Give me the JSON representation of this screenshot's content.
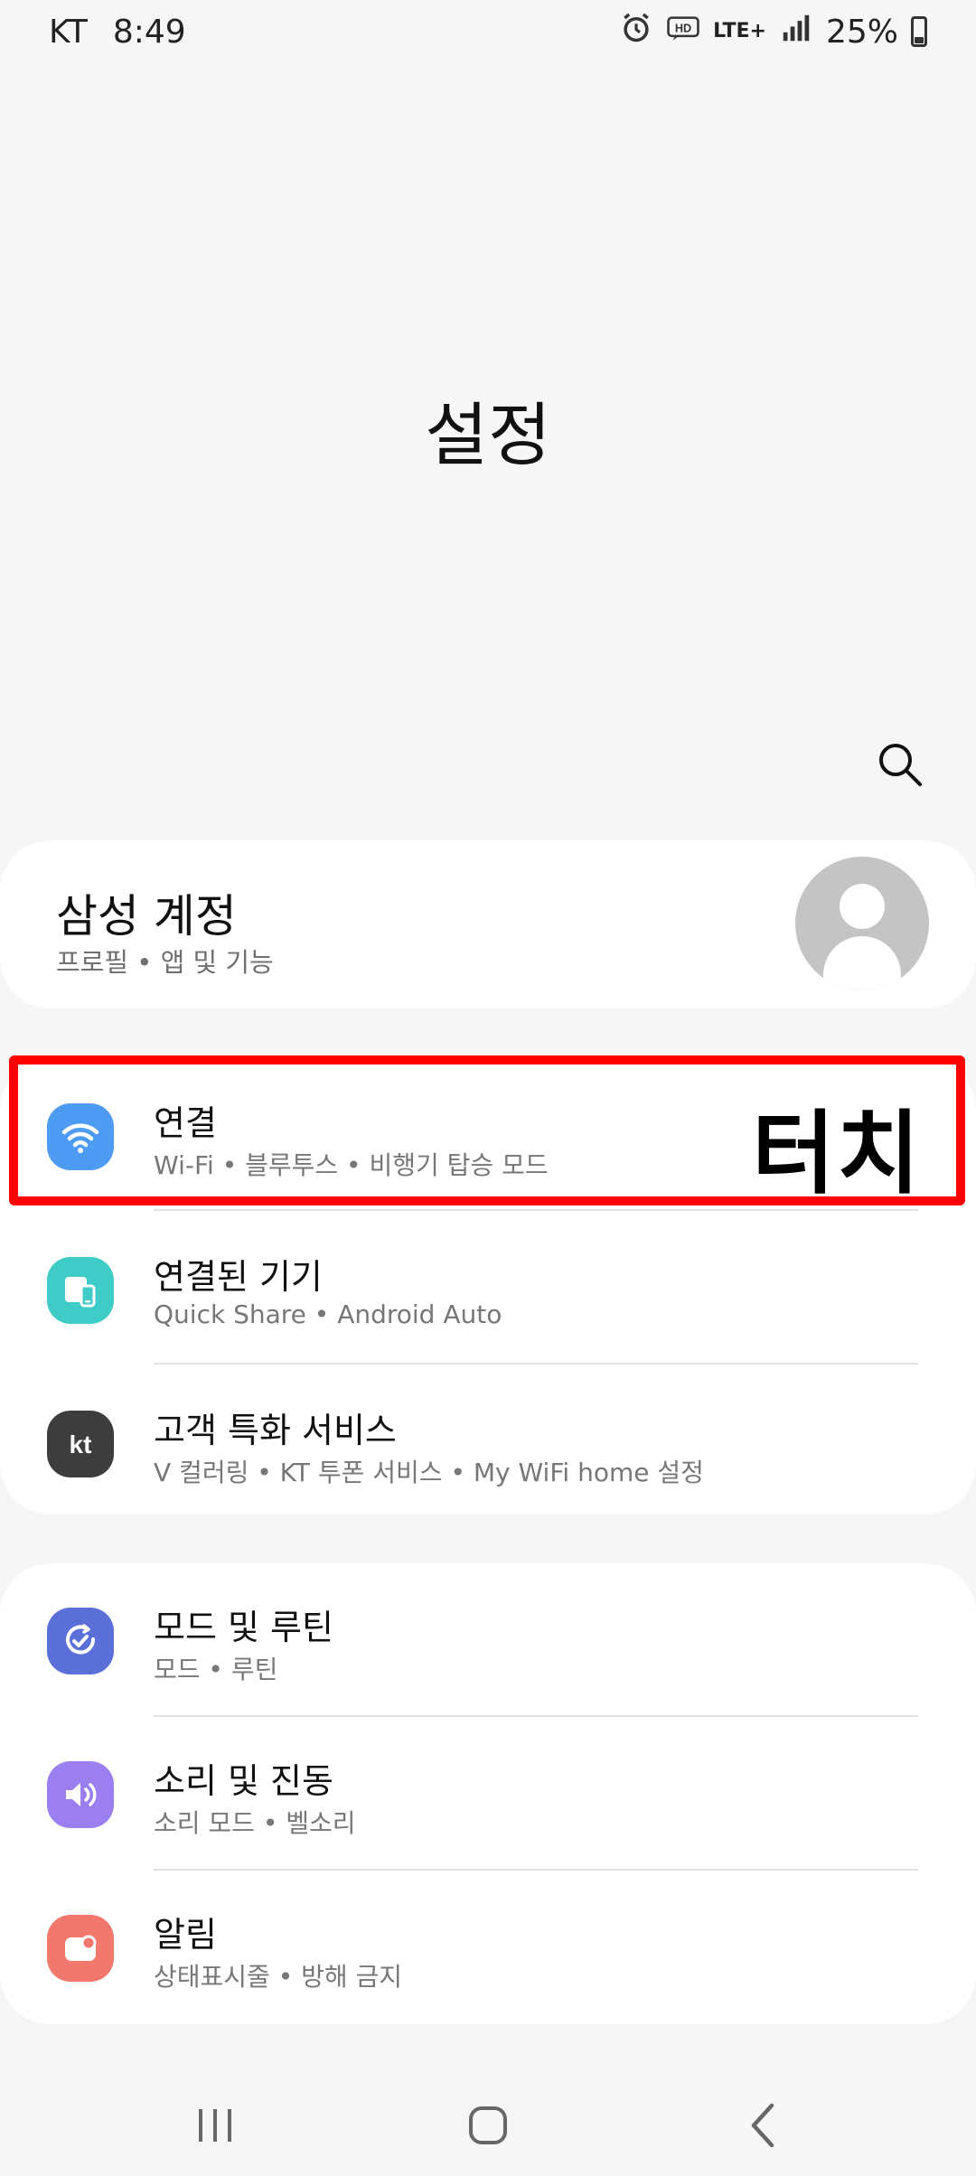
{
  "status_bar": {
    "carrier": "KT",
    "time": "8:49",
    "network": "LTE+",
    "battery": "25%"
  },
  "header": {
    "title": "설정"
  },
  "account": {
    "title": "삼성 계정",
    "subtitle": "프로필 • 앱 및 기능"
  },
  "groups": [
    {
      "items": [
        {
          "title": "연결",
          "subtitle": "Wi-Fi • 블루투스 • 비행기 탑승 모드",
          "icon": "wifi-icon",
          "color": "#4e9bf4"
        },
        {
          "title": "연결된 기기",
          "subtitle": "Quick Share • Android Auto",
          "icon": "connected-devices-icon",
          "color": "#3fcbc7"
        },
        {
          "title": "고객 특화 서비스",
          "subtitle": "V 컬러링 • KT 투폰 서비스 • My WiFi home 설정",
          "icon": "kt-logo-icon",
          "color": "#3d3d3d"
        }
      ]
    },
    {
      "items": [
        {
          "title": "모드 및 루틴",
          "subtitle": "모드 • 루틴",
          "icon": "modes-routines-icon",
          "color": "#5b6fd9"
        },
        {
          "title": "소리 및 진동",
          "subtitle": "소리 모드 • 벨소리",
          "icon": "sound-icon",
          "color": "#9b7ef0"
        },
        {
          "title": "알림",
          "subtitle": "상태표시줄 • 방해 금지",
          "icon": "notification-icon",
          "color": "#f2776c"
        }
      ]
    }
  ],
  "annotation": {
    "label": "터치",
    "color": "#ff0000"
  }
}
